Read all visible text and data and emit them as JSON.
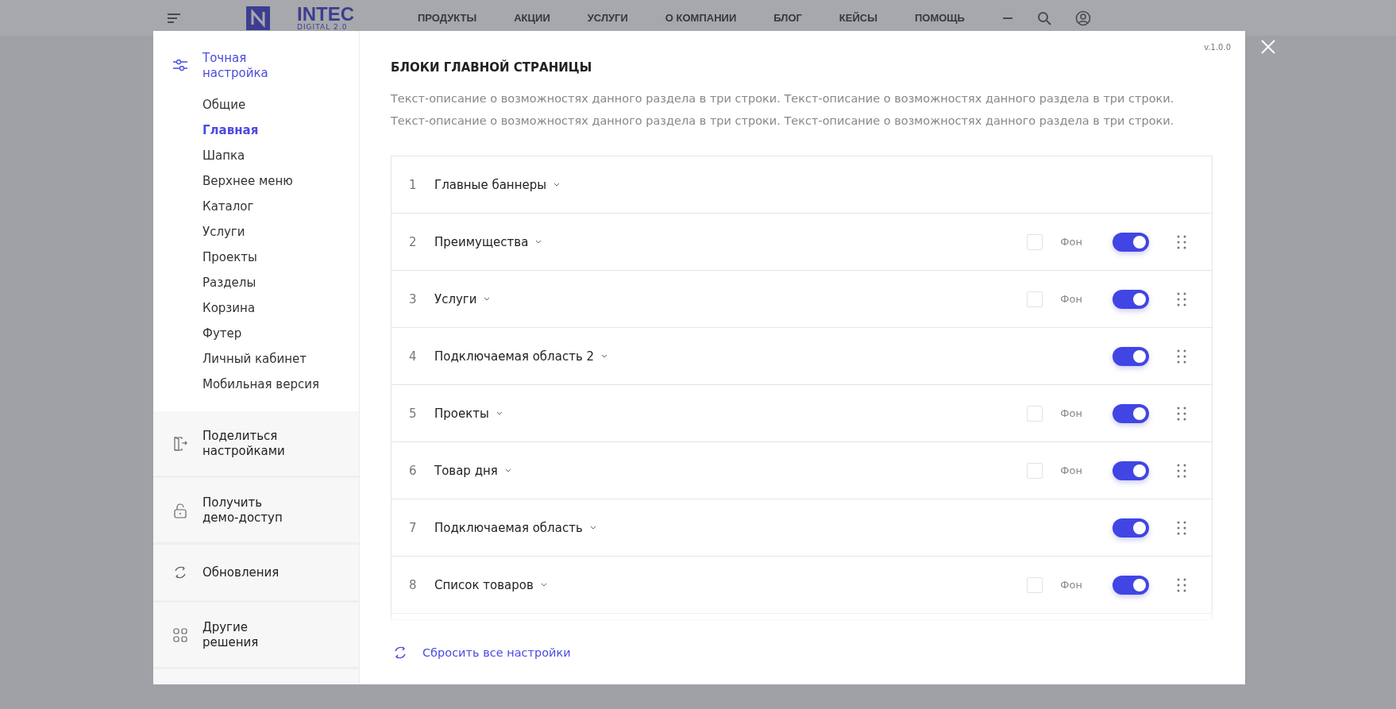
{
  "site_header": {
    "logo": "INTEC",
    "logo_sub": "DIGITAL 2.0",
    "nav": [
      "ПРОДУКТЫ",
      "АКЦИИ",
      "УСЛУГИ",
      "О КОМПАНИИ",
      "БЛОГ",
      "КЕЙСЫ",
      "ПОМОЩЬ"
    ]
  },
  "modal": {
    "version": "v.1.0.0",
    "sidebar": {
      "heading": "Точная настройка",
      "items": [
        {
          "label": "Общие",
          "selected": false
        },
        {
          "label": "Главная",
          "selected": true
        },
        {
          "label": "Шапка",
          "selected": false
        },
        {
          "label": "Верхнее меню",
          "selected": false
        },
        {
          "label": "Каталог",
          "selected": false
        },
        {
          "label": "Услуги",
          "selected": false
        },
        {
          "label": "Проекты",
          "selected": false
        },
        {
          "label": "Разделы",
          "selected": false
        },
        {
          "label": "Корзина",
          "selected": false
        },
        {
          "label": "Футер",
          "selected": false
        },
        {
          "label": "Личный кабинет",
          "selected": false
        },
        {
          "label": "Мобильная версия",
          "selected": false
        }
      ],
      "actions": [
        {
          "kind": "share",
          "label": "Поделиться настройками"
        },
        {
          "kind": "lock",
          "label": "Получить демо-доступ"
        },
        {
          "kind": "refresh",
          "label": "Обновления"
        },
        {
          "kind": "grid",
          "label": "Другие решения"
        }
      ]
    },
    "title": "БЛОКИ ГЛАВНОЙ СТРАНИЦЫ",
    "description": "Текст-описание о возможностях данного раздела в три строки. Текст-описание о возможностях данного раздела в три строки. Текст-описание о возможностях данного раздела в три строки. Текст-описание о возможностях данного раздела в три строки.",
    "blocks": [
      {
        "kind": "fixed",
        "number": "1",
        "label": "Главные баннеры"
      },
      {
        "kind": "movable",
        "number": "2",
        "label": "Преимущества",
        "background": {
          "label": "Фон",
          "checked": false
        },
        "on": true
      },
      {
        "kind": "movable",
        "number": "3",
        "label": "Услуги",
        "background": {
          "label": "Фон",
          "checked": false
        },
        "on": true
      },
      {
        "kind": "movable",
        "number": "4",
        "label": "Подключаемая область 2",
        "on": true
      },
      {
        "kind": "movable",
        "number": "5",
        "label": "Проекты",
        "background": {
          "label": "Фон",
          "checked": false
        },
        "on": true
      },
      {
        "kind": "movable",
        "number": "6",
        "label": "Товар дня",
        "background": {
          "label": "Фон",
          "checked": false
        },
        "on": true
      },
      {
        "kind": "movable",
        "number": "7",
        "label": "Подключаемая область",
        "on": true
      },
      {
        "kind": "movable",
        "number": "8",
        "label": "Список товаров",
        "background": {
          "label": "Фон",
          "checked": false
        },
        "on": true
      }
    ],
    "reset": "Сбросить все настройки"
  }
}
